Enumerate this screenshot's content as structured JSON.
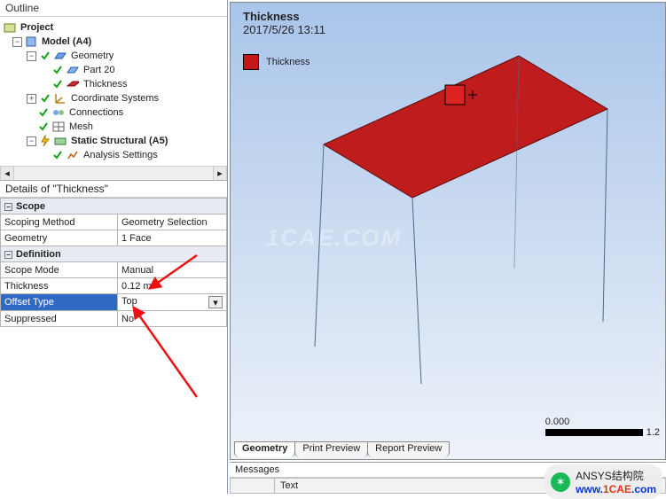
{
  "outline": {
    "title": "Outline",
    "tree": {
      "project": "Project",
      "model": "Model (A4)",
      "geometry": "Geometry",
      "part": "Part 20",
      "thickness_node": "Thickness",
      "coord": "Coordinate Systems",
      "connections": "Connections",
      "mesh": "Mesh",
      "static": "Static Structural (A5)",
      "analysis": "Analysis Settings"
    }
  },
  "details": {
    "title": "Details of \"Thickness\"",
    "sections": {
      "scope": "Scope",
      "definition": "Definition"
    },
    "rows": {
      "scoping_method": {
        "k": "Scoping Method",
        "v": "Geometry Selection"
      },
      "geometry": {
        "k": "Geometry",
        "v": "1 Face"
      },
      "scope_mode": {
        "k": "Scope Mode",
        "v": "Manual"
      },
      "thickness": {
        "k": "Thickness",
        "v": "0.12 m"
      },
      "offset_type": {
        "k": "Offset Type",
        "v": "Top"
      },
      "suppressed": {
        "k": "Suppressed",
        "v": "No"
      }
    }
  },
  "viewport": {
    "title": "Thickness",
    "timestamp": "2017/5/26 13:11",
    "legend": "Thickness",
    "watermark": "1CAE.COM",
    "scale_zero": "0.000",
    "scale_half": "1.2"
  },
  "tabs": {
    "geometry": "Geometry",
    "print": "Print Preview",
    "report": "Report Preview"
  },
  "messages": {
    "title": "Messages",
    "col_text": "Text"
  },
  "badge": {
    "label": "ANSYS结构院",
    "site_a": "www.",
    "site_b": "1CAE",
    "site_c": ".com"
  }
}
